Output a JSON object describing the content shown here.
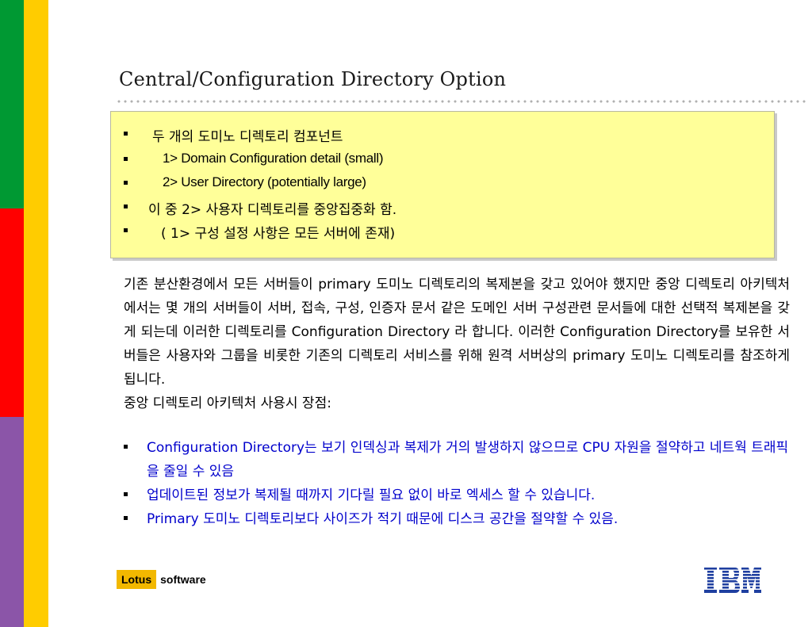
{
  "slide": {
    "title": "Central/Configuration Directory Option",
    "box_items": [
      "두 개의 도미노 디렉토리 컴포넌트",
      "1> Domain Configuration detail (small)",
      "2>  User Directory (potentially large)",
      "이 중  2> 사용자 디렉토리를 중앙집중화 함.",
      "( 1> 구성 설정 사항은 모든 서버에 존재)"
    ],
    "paragraph": "기존 분산환경에서 모든 서버들이 primary 도미노 디렉토리의 복제본을 갖고 있어야 했지만 중앙 디렉토리 아키텍처에서는 몇 개의 서버들이 서버, 접속, 구성, 인증자 문서 같은 도메인 서버 구성관련 문서들에 대한 선택적 복제본을 갖게 되는데 이러한 디렉토리를 Configuration Directory 라 합니다. 이러한 Configuration Directory를 보유한 서버들은 사용자와 그룹을 비롯한 기존의 디렉토리 서비스를 위해 원격 서버상의 primary 도미노 디렉토리를 참조하게 됩니다.",
    "advantages_heading": "중앙 디렉토리 아키텍처 사용시 장점:",
    "advantages": [
      "Configuration Directory는 보기 인덱싱과 복제가 거의 발생하지 않으므로 CPU 자원을 절약하고 네트웍 트래픽을 줄일 수 있음",
      "업데이트된 정보가 복제될 때까지 기다릴 필요 없이 바로  엑세스 할 수 있습니다.",
      "Primary 도미노 디렉토리보다 사이즈가 적기 때문에 디스크 공간을  절약할 수 있음."
    ]
  },
  "footer": {
    "lotus_label": "Lotus",
    "software_label": "software",
    "ibm_label": "IBM"
  },
  "colors": {
    "green": "#009933",
    "red": "#ff0000",
    "purple": "#8b55a8",
    "yellow": "#ffcc00",
    "box_fill": "#ffff99",
    "link_blue": "#0000cc"
  }
}
